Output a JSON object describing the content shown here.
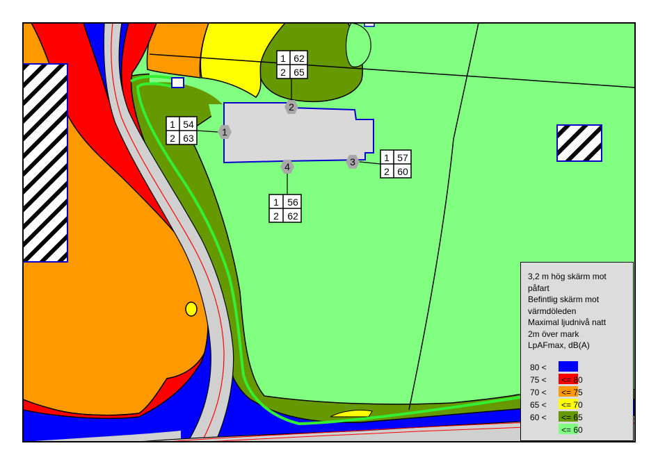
{
  "legend": {
    "lines": [
      "3,2 m hög skärm mot",
      "påfart",
      "Befintlig skärm mot",
      "värmdöleden",
      "Maximal ljudnivå natt",
      "2m över mark",
      "LpAFmax, dB(A)"
    ],
    "classes": [
      {
        "low": "80 <",
        "high": "",
        "color": "#0000ff"
      },
      {
        "low": "75 <",
        "high": "<= 80",
        "color": "#ff0000"
      },
      {
        "low": "70 <",
        "high": "<= 75",
        "color": "#ff9900"
      },
      {
        "low": "65 <",
        "high": "<= 70",
        "color": "#ffff00"
      },
      {
        "low": "60 <",
        "high": "<= 65",
        "color": "#669900"
      },
      {
        "low": "",
        "high": "<= 60",
        "color": "#80ff80"
      }
    ]
  },
  "receivers": [
    {
      "id": "1",
      "floors": [
        {
          "floor": "1",
          "level": "54"
        },
        {
          "floor": "2",
          "level": "63"
        }
      ]
    },
    {
      "id": "2",
      "floors": [
        {
          "floor": "1",
          "level": "62"
        },
        {
          "floor": "2",
          "level": "65"
        }
      ]
    },
    {
      "id": "3",
      "floors": [
        {
          "floor": "1",
          "level": "57"
        },
        {
          "floor": "2",
          "level": "60"
        }
      ]
    },
    {
      "id": "4",
      "floors": [
        {
          "floor": "1",
          "level": "56"
        },
        {
          "floor": "2",
          "level": "62"
        }
      ]
    }
  ]
}
